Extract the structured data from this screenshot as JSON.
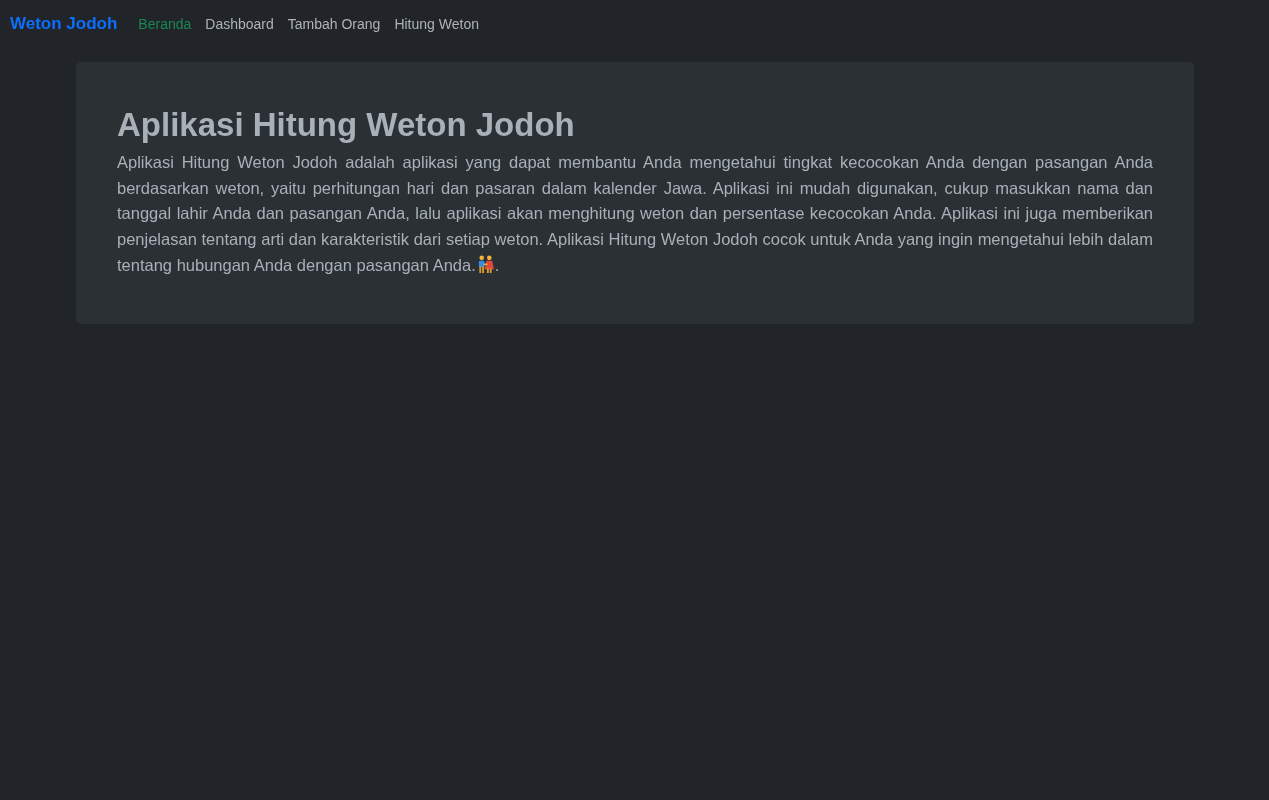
{
  "navbar": {
    "brand": "Weton Jodoh",
    "items": [
      {
        "label": "Beranda",
        "selected": true
      },
      {
        "label": "Dashboard",
        "selected": false
      },
      {
        "label": "Tambah Orang",
        "selected": false
      },
      {
        "label": "Hitung Weton",
        "selected": false
      }
    ]
  },
  "hero": {
    "title": "Aplikasi Hitung Weton Jodoh",
    "text": "Aplikasi Hitung Weton Jodoh adalah aplikasi yang dapat membantu Anda mengetahui tingkat kecocokan Anda dengan pasangan Anda berdasarkan weton, yaitu perhitungan hari dan pasaran dalam kalender Jawa. Aplikasi ini mudah digunakan, cukup masukkan nama dan tanggal lahir Anda dan pasangan Anda, lalu aplikasi akan menghitung weton dan persentase kecocokan Anda. Aplikasi ini juga memberikan penjelasan tentang arti dan karakteristik dari setiap weton. Aplikasi Hitung Weton Jodoh cocok untuk Anda yang ingin mengetahui lebih dalam",
    "text_last": "tentang hubungan Anda dengan pasangan Anda.",
    "text_end": "."
  }
}
